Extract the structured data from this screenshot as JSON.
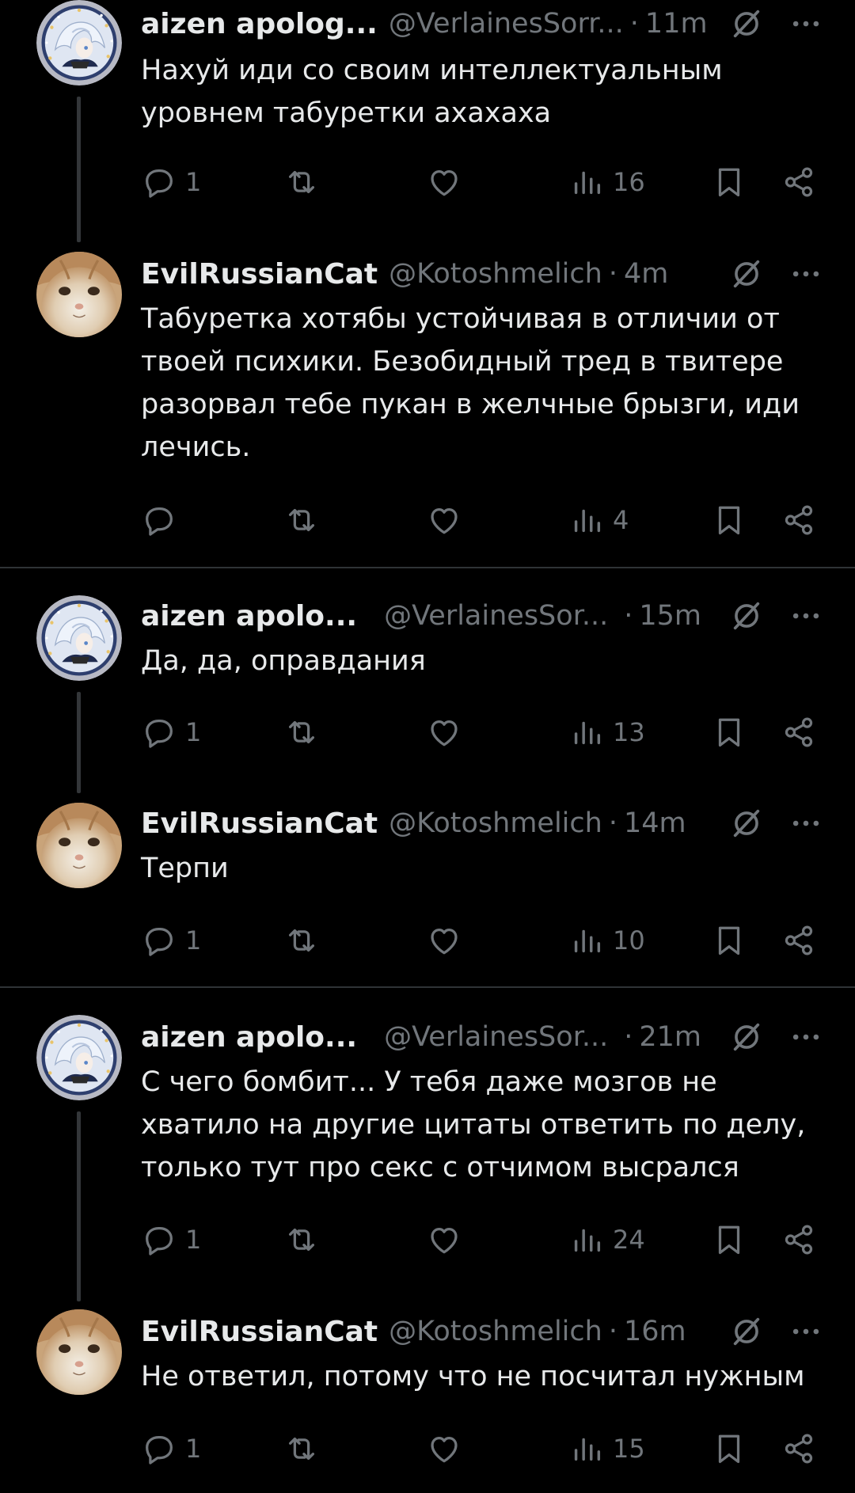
{
  "tweets": [
    {
      "name": "aizen apolog...",
      "handle": "@VerlainesSorr...",
      "time": "11m",
      "text": "Нахуй иди со своим интеллектуальным уровнем табуретки ахахаха",
      "replies": "1",
      "views": "16",
      "avatar": "anime"
    },
    {
      "name": "EvilRussianCat",
      "handle": "@Kotoshmelich",
      "time": "4m",
      "text": "Табуретка хотябы устойчивая в отличии от твоей психики. Безобидный тред в твитере разорвал тебе пукан в желчные брызги, иди лечись.",
      "replies": "",
      "views": "4",
      "avatar": "cat"
    },
    {
      "name": "aizen apolo...",
      "handle": "@VerlainesSor...",
      "time": "15m",
      "text": "Да, да, оправдания",
      "replies": "1",
      "views": "13",
      "avatar": "anime"
    },
    {
      "name": "EvilRussianCat",
      "handle": "@Kotoshmelich",
      "time": "14m",
      "text": "Терпи",
      "replies": "1",
      "views": "10",
      "avatar": "cat"
    },
    {
      "name": "aizen apolo...",
      "handle": "@VerlainesSor...",
      "time": "21m",
      "text": "С чего бомбит... У тебя даже мозгов не хватило на другие цитаты ответить по делу, только тут про секс с отчимом высрался",
      "replies": "1",
      "views": "24",
      "avatar": "anime"
    },
    {
      "name": "EvilRussianCat",
      "handle": "@Kotoshmelich",
      "time": "16m",
      "text": "Не ответил, потому что не посчитал нужным",
      "replies": "1",
      "views": "15",
      "avatar": "cat"
    }
  ],
  "separator": "·",
  "icons": {
    "reply": "reply-bubble-icon",
    "repost": "repost-icon",
    "like": "heart-icon",
    "views": "views-bar-chart-icon",
    "bookmark": "bookmark-icon",
    "share": "share-icon",
    "grok": "slashed-circle-icon",
    "more": "more-dots-icon"
  },
  "colors": {
    "background": "#000000",
    "text": "#e7e9ea",
    "muted": "#71767b",
    "divider": "#2f3336"
  }
}
